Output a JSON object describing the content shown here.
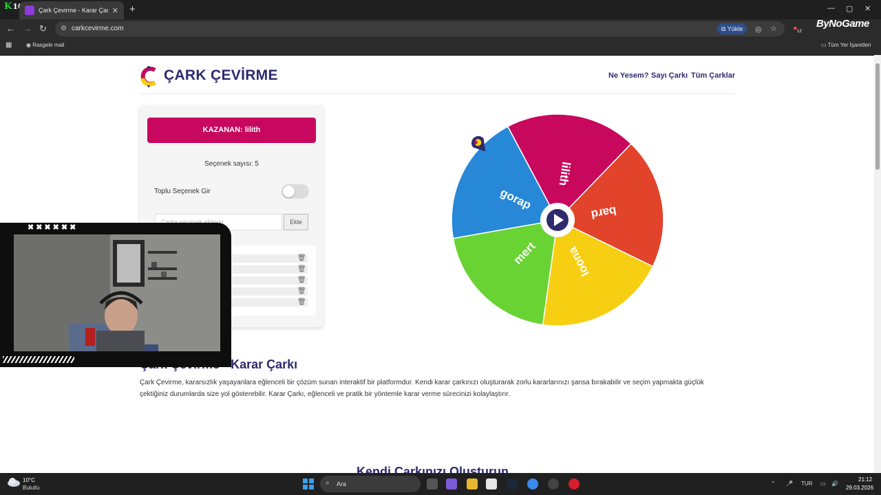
{
  "browser": {
    "tab_title": "Çark Çevirme - Karar Çarkı",
    "url": "carkcevirme.com",
    "install_chip": "Yükle",
    "bookmark_item": "Rasgele mail",
    "all_bookmarks": "Tüm Yer İşaretleri",
    "overlay_counter": "10",
    "overlay_brand": "ByNoGame",
    "ext_badge": "12"
  },
  "site": {
    "title": "ÇARK ÇEVİRME",
    "nav": [
      "Ne Yesem?",
      "Sayı Çarkı",
      "Tüm Çarklar"
    ]
  },
  "panel": {
    "winner": "KAZANAN: lilith",
    "option_count": "Seçenek sayısı: 5",
    "bulk_label": "Toplu Seçenek Gir",
    "bulk_enabled": false,
    "input_placeholder": "Çarka seçenek ekleyin",
    "add_button": "Ekle"
  },
  "wheel": {
    "segments": [
      {
        "label": "lilith",
        "color": "#c8085c"
      },
      {
        "label": "bard",
        "color": "#e2432b"
      },
      {
        "label": "loona",
        "color": "#f6cf12"
      },
      {
        "label": "mert",
        "color": "#6ad334"
      },
      {
        "label": "gorap",
        "color": "#2788d8"
      }
    ]
  },
  "section": {
    "title": "Çark Çevirme - Karar Çarkı",
    "body": "Çark Çevirme, kararsızlık yaşayanlara eğlenceli bir çözüm sunan interaktif bir platformdur. Kendi karar çarkınızı oluşturarak zorlu kararlarınızı şansa bırakabilir ve seçim yapmakta güçlük çektiğiniz durumlarda size yol gösterebilir. Karar Çarkı, eğlenceli ve pratik bir yöntemle karar verme sürecinizi kolaylaştırır.",
    "title2": "Kendi Çarkınızı Oluşturun"
  },
  "taskbar": {
    "temp": "10°C",
    "weather": "Bulutlu",
    "search": "Ara",
    "lang": "TUR",
    "time": "21:12",
    "date": "29.03.2026"
  },
  "colors": {
    "brand_dark": "#2e2a6e",
    "winner_bg": "#c7085e"
  }
}
